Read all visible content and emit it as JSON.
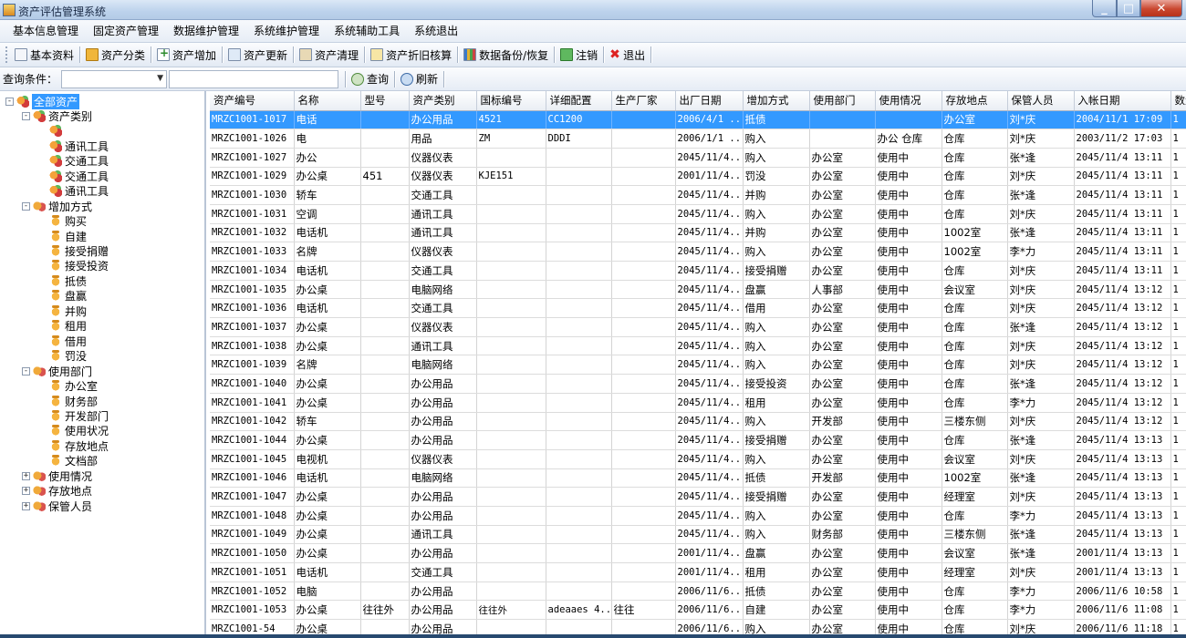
{
  "window": {
    "title": "资产评估管理系统",
    "min": "_",
    "max": "□",
    "close": "✕"
  },
  "menu": [
    "基本信息管理",
    "固定资产管理",
    "数据维护管理",
    "系统维护管理",
    "系统辅助工具",
    "系统退出"
  ],
  "toolbar": {
    "basic": "基本资料",
    "category": "资产分类",
    "add": "资产增加",
    "update": "资产更新",
    "clean": "资产清理",
    "depreciation": "资产折旧核算",
    "backup": "数据备份/恢复",
    "logout": "注销",
    "exit": "退出"
  },
  "query": {
    "label": "查询条件：",
    "search": "查询",
    "refresh": "刷新"
  },
  "tree": [
    {
      "text": "全部资产",
      "level": 0,
      "exp": "-",
      "icon": "cat",
      "sel": true
    },
    {
      "text": "资产类别",
      "level": 1,
      "exp": "-",
      "icon": "cat"
    },
    {
      "text": "",
      "level": 2,
      "icon": "cat"
    },
    {
      "text": "通讯工具",
      "level": 2,
      "icon": "cat"
    },
    {
      "text": "交通工具",
      "level": 2,
      "icon": "cat"
    },
    {
      "text": "交通工具",
      "level": 2,
      "icon": "cat"
    },
    {
      "text": "通讯工具",
      "level": 2,
      "icon": "cat"
    },
    {
      "text": "增加方式",
      "level": 1,
      "exp": "-",
      "icon": "grp"
    },
    {
      "text": "购买",
      "level": 2,
      "icon": "leaf"
    },
    {
      "text": "自建",
      "level": 2,
      "icon": "leaf"
    },
    {
      "text": "接受捐赠",
      "level": 2,
      "icon": "leaf"
    },
    {
      "text": "接受投资",
      "level": 2,
      "icon": "leaf"
    },
    {
      "text": "抵债",
      "level": 2,
      "icon": "leaf"
    },
    {
      "text": "盘赢",
      "level": 2,
      "icon": "leaf"
    },
    {
      "text": "并购",
      "level": 2,
      "icon": "leaf"
    },
    {
      "text": "租用",
      "level": 2,
      "icon": "leaf"
    },
    {
      "text": "借用",
      "level": 2,
      "icon": "leaf"
    },
    {
      "text": "罚没",
      "level": 2,
      "icon": "leaf"
    },
    {
      "text": "使用部门",
      "level": 1,
      "exp": "-",
      "icon": "grp"
    },
    {
      "text": "办公室",
      "level": 2,
      "icon": "leaf"
    },
    {
      "text": "财务部",
      "level": 2,
      "icon": "leaf"
    },
    {
      "text": "开发部门",
      "level": 2,
      "icon": "leaf"
    },
    {
      "text": "使用状况",
      "level": 2,
      "icon": "leaf"
    },
    {
      "text": "存放地点",
      "level": 2,
      "icon": "leaf"
    },
    {
      "text": "文档部",
      "level": 2,
      "icon": "leaf"
    },
    {
      "text": "使用情况",
      "level": 1,
      "exp": "+",
      "icon": "grp"
    },
    {
      "text": "存放地点",
      "level": 1,
      "exp": "+",
      "icon": "grp"
    },
    {
      "text": "保管人员",
      "level": 1,
      "exp": "+",
      "icon": "grp"
    }
  ],
  "grid": {
    "columns": [
      "资产编号",
      "名称",
      "型号",
      "资产类别",
      "国标编号",
      "详细配置",
      "生产厂家",
      "出厂日期",
      "增加方式",
      "使用部门",
      "使用情况",
      "存放地点",
      "保管人员",
      "入帐日期",
      "数量"
    ],
    "rows": [
      [
        "MRZC1001-1017",
        "电话",
        "",
        "办公用品",
        "4521",
        "CC1200",
        "",
        "2006/4/1 ...",
        "抵债",
        "",
        "",
        "办公室",
        "刘*庆",
        "2004/11/1 17:09",
        "1"
      ],
      [
        "MRZC1001-1026",
        "电",
        "",
        "用品",
        "ZM",
        "DDDI",
        "",
        "2006/1/1 ...",
        "购入",
        "",
        "办公 仓库",
        "仓库",
        "刘*庆",
        "2003/11/2 17:03",
        "1"
      ],
      [
        "MRZC1001-1027",
        "办公",
        "",
        "仪器仪表",
        "",
        "",
        "",
        "2045/11/4...",
        "购入",
        "办公室",
        "使用中",
        "仓库",
        "张*逢",
        "2045/11/4 13:11",
        "1"
      ],
      [
        "MRZC1001-1029",
        "办公桌",
        "451",
        "仪器仪表",
        "KJE151",
        "",
        "",
        "2001/11/4...",
        "罚没",
        "办公室",
        "使用中",
        "仓库",
        "刘*庆",
        "2045/11/4 13:11",
        "1"
      ],
      [
        "MRZC1001-1030",
        "轿车",
        "",
        "交通工具",
        "",
        "",
        "",
        "2045/11/4...",
        "并购",
        "办公室",
        "使用中",
        "仓库",
        "张*逢",
        "2045/11/4 13:11",
        "1"
      ],
      [
        "MRZC1001-1031",
        "空调",
        "",
        "通讯工具",
        "",
        "",
        "",
        "2045/11/4...",
        "购入",
        "办公室",
        "使用中",
        "仓库",
        "刘*庆",
        "2045/11/4 13:11",
        "1"
      ],
      [
        "MRZC1001-1032",
        "电话机",
        "",
        "通讯工具",
        "",
        "",
        "",
        "2045/11/4...",
        "并购",
        "办公室",
        "使用中",
        "1002室",
        "张*逢",
        "2045/11/4 13:11",
        "1"
      ],
      [
        "MRZC1001-1033",
        "名牌",
        "",
        "仪器仪表",
        "",
        "",
        "",
        "2045/11/4...",
        "购入",
        "办公室",
        "使用中",
        "1002室",
        "李*力",
        "2045/11/4 13:11",
        "1"
      ],
      [
        "MRZC1001-1034",
        "电话机",
        "",
        "交通工具",
        "",
        "",
        "",
        "2045/11/4...",
        "接受捐赠",
        "办公室",
        "使用中",
        "仓库",
        "刘*庆",
        "2045/11/4 13:11",
        "1"
      ],
      [
        "MRZC1001-1035",
        "办公桌",
        "",
        "电脑网络",
        "",
        "",
        "",
        "2045/11/4...",
        "盘赢",
        "人事部",
        "使用中",
        "会议室",
        "刘*庆",
        "2045/11/4 13:12",
        "1"
      ],
      [
        "MRZC1001-1036",
        "电话机",
        "",
        "交通工具",
        "",
        "",
        "",
        "2045/11/4...",
        "借用",
        "办公室",
        "使用中",
        "仓库",
        "刘*庆",
        "2045/11/4 13:12",
        "1"
      ],
      [
        "MRZC1001-1037",
        "办公桌",
        "",
        "仪器仪表",
        "",
        "",
        "",
        "2045/11/4...",
        "购入",
        "办公室",
        "使用中",
        "仓库",
        "张*逢",
        "2045/11/4 13:12",
        "1"
      ],
      [
        "MRZC1001-1038",
        "办公桌",
        "",
        "通讯工具",
        "",
        "",
        "",
        "2045/11/4...",
        "购入",
        "办公室",
        "使用中",
        "仓库",
        "刘*庆",
        "2045/11/4 13:12",
        "1"
      ],
      [
        "MRZC1001-1039",
        "名牌",
        "",
        "电脑网络",
        "",
        "",
        "",
        "2045/11/4...",
        "购入",
        "办公室",
        "使用中",
        "仓库",
        "刘*庆",
        "2045/11/4 13:12",
        "1"
      ],
      [
        "MRZC1001-1040",
        "办公桌",
        "",
        "办公用品",
        "",
        "",
        "",
        "2045/11/4...",
        "接受投资",
        "办公室",
        "使用中",
        "仓库",
        "张*逢",
        "2045/11/4 13:12",
        "1"
      ],
      [
        "MRZC1001-1041",
        "办公桌",
        "",
        "办公用品",
        "",
        "",
        "",
        "2045/11/4...",
        "租用",
        "办公室",
        "使用中",
        "仓库",
        "李*力",
        "2045/11/4 13:12",
        "1"
      ],
      [
        "MRZC1001-1042",
        "轿车",
        "",
        "办公用品",
        "",
        "",
        "",
        "2045/11/4...",
        "购入",
        "开发部",
        "使用中",
        "三楼东侧",
        "刘*庆",
        "2045/11/4 13:12",
        "1"
      ],
      [
        "MRZC1001-1044",
        "办公桌",
        "",
        "办公用品",
        "",
        "",
        "",
        "2045/11/4...",
        "接受捐赠",
        "办公室",
        "使用中",
        "仓库",
        "张*逢",
        "2045/11/4 13:13",
        "1"
      ],
      [
        "MRZC1001-1045",
        "电视机",
        "",
        "仪器仪表",
        "",
        "",
        "",
        "2045/11/4...",
        "购入",
        "办公室",
        "使用中",
        "会议室",
        "刘*庆",
        "2045/11/4 13:13",
        "1"
      ],
      [
        "MRZC1001-1046",
        "电话机",
        "",
        "电脑网络",
        "",
        "",
        "",
        "2045/11/4...",
        "抵债",
        "开发部",
        "使用中",
        "1002室",
        "张*逢",
        "2045/11/4 13:13",
        "1"
      ],
      [
        "MRZC1001-1047",
        "办公桌",
        "",
        "办公用品",
        "",
        "",
        "",
        "2045/11/4...",
        "接受捐赠",
        "办公室",
        "使用中",
        "经理室",
        "刘*庆",
        "2045/11/4 13:13",
        "1"
      ],
      [
        "MRZC1001-1048",
        "办公桌",
        "",
        "办公用品",
        "",
        "",
        "",
        "2045/11/4...",
        "购入",
        "办公室",
        "使用中",
        "仓库",
        "李*力",
        "2045/11/4 13:13",
        "1"
      ],
      [
        "MRZC1001-1049",
        "办公桌",
        "",
        "通讯工具",
        "",
        "",
        "",
        "2045/11/4...",
        "购入",
        "财务部",
        "使用中",
        "三楼东侧",
        "张*逢",
        "2045/11/4 13:13",
        "1"
      ],
      [
        "MRZC1001-1050",
        "办公桌",
        "",
        "办公用品",
        "",
        "",
        "",
        "2001/11/4...",
        "盘赢",
        "办公室",
        "使用中",
        "会议室",
        "张*逢",
        "2001/11/4 13:13",
        "1"
      ],
      [
        "MRZC1001-1051",
        "电话机",
        "",
        "交通工具",
        "",
        "",
        "",
        "2001/11/4...",
        "租用",
        "办公室",
        "使用中",
        "经理室",
        "刘*庆",
        "2001/11/4 13:13",
        "1"
      ],
      [
        "MRZC1001-1052",
        "电脑",
        "",
        "办公用品",
        "",
        "",
        "",
        "2006/11/6...",
        "抵债",
        "办公室",
        "使用中",
        "仓库",
        "李*力",
        "2006/11/6 10:58",
        "1"
      ],
      [
        "MRZC1001-1053",
        "办公桌",
        "往往外",
        "办公用品",
        "往往外",
        "adeaaes 4...",
        "往往",
        "2006/11/6...",
        "自建",
        "办公室",
        "使用中",
        "仓库",
        "李*力",
        "2006/11/6 11:08",
        "1"
      ],
      [
        "MRZC1001-54",
        "办公桌",
        "",
        "办公用品",
        "",
        "",
        "",
        "2006/11/6...",
        "购入",
        "办公室",
        "使用中",
        "仓库",
        "刘*庆",
        "2006/11/6 11:18",
        "1"
      ]
    ]
  },
  "colors": {
    "selection": "#3399ff",
    "titlebar": "#bcd2ec",
    "close": "#c9472f"
  }
}
